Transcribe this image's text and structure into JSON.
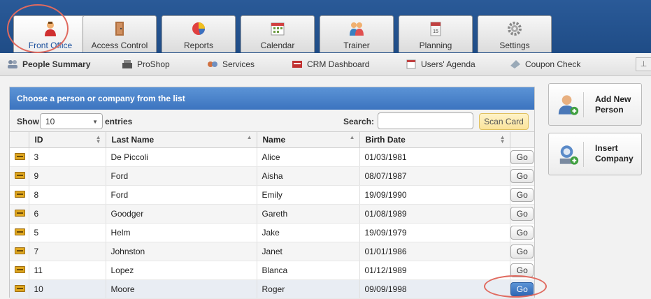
{
  "top_tabs": [
    {
      "label": "Front Office",
      "icon": "person-icon"
    },
    {
      "label": "Access Control",
      "icon": "door-icon"
    },
    {
      "label": "Reports",
      "icon": "pie-chart-icon"
    },
    {
      "label": "Calendar",
      "icon": "calendar-icon"
    },
    {
      "label": "Trainer",
      "icon": "trainer-icon"
    },
    {
      "label": "Planning",
      "icon": "planner-icon"
    },
    {
      "label": "Settings",
      "icon": "gear-icon"
    }
  ],
  "sub_nav": [
    {
      "label": "People Summary",
      "icon": "people-icon"
    },
    {
      "label": "ProShop",
      "icon": "register-icon"
    },
    {
      "label": "Services",
      "icon": "services-icon"
    },
    {
      "label": "CRM Dashboard",
      "icon": "crm-icon"
    },
    {
      "label": "Users' Agenda",
      "icon": "agenda-icon"
    },
    {
      "label": "Coupon Check",
      "icon": "coupon-icon"
    }
  ],
  "panel": {
    "title": "Choose a person or company from the list",
    "show_label": "Show",
    "entries_value": "10",
    "entries_label": "entries",
    "search_label": "Search:",
    "search_value": "",
    "scan_button": "Scan Card"
  },
  "table": {
    "columns": [
      "ID",
      "Last Name",
      "Name",
      "Birth Date"
    ],
    "go_label": "Go",
    "rows": [
      {
        "id": "3",
        "last": "De Piccoli",
        "name": "Alice",
        "birth": "01/03/1981"
      },
      {
        "id": "9",
        "last": "Ford",
        "name": "Aisha",
        "birth": "08/07/1987"
      },
      {
        "id": "8",
        "last": "Ford",
        "name": "Emily",
        "birth": "19/09/1990"
      },
      {
        "id": "6",
        "last": "Goodger",
        "name": "Gareth",
        "birth": "01/08/1989"
      },
      {
        "id": "5",
        "last": "Helm",
        "name": "Jake",
        "birth": "19/09/1979"
      },
      {
        "id": "7",
        "last": "Johnston",
        "name": "Janet",
        "birth": "01/01/1986"
      },
      {
        "id": "11",
        "last": "Lopez",
        "name": "Blanca",
        "birth": "01/12/1989"
      },
      {
        "id": "10",
        "last": "Moore",
        "name": "Roger",
        "birth": "09/09/1998"
      }
    ]
  },
  "side": {
    "add_person": [
      "Add New",
      "Person"
    ],
    "insert_company": [
      "Insert",
      "Company"
    ]
  },
  "colors": {
    "accent": "#3c74bf",
    "highlight": "#e06a5f",
    "topbar": "#2a5a98"
  }
}
